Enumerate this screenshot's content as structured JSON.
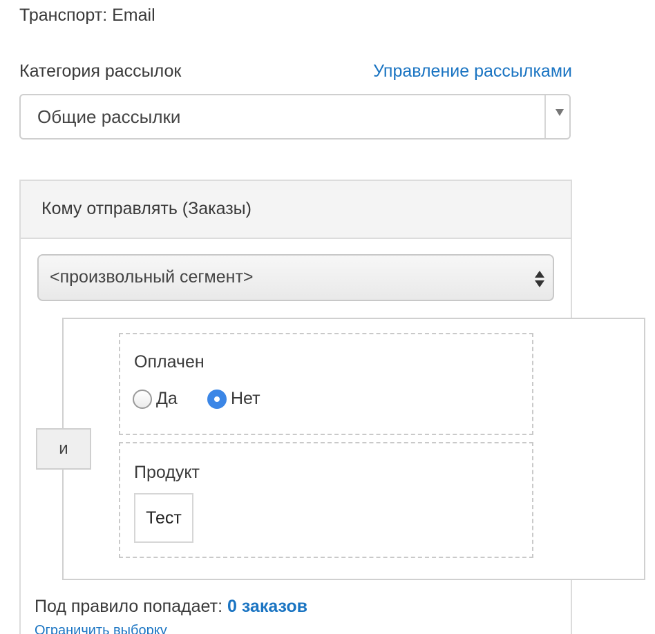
{
  "transport": {
    "label": "Транспорт: Email"
  },
  "category": {
    "label": "Категория рассылок",
    "manage_link": "Управление рассылками",
    "selected": "Общие рассылки"
  },
  "recipients": {
    "title": "Кому отправлять (Заказы)",
    "segment_selected": "<произвольный сегмент>",
    "combinator": "и",
    "conditions": {
      "paid": {
        "title": "Оплачен",
        "options": [
          {
            "label": "Да",
            "checked": false
          },
          {
            "label": "Нет",
            "checked": true
          }
        ]
      },
      "product": {
        "title": "Продукт",
        "value": "Тест"
      }
    }
  },
  "result": {
    "prefix": "Под правило попадает:",
    "count": "0 заказов",
    "limit_link": "Ограничить выборку"
  },
  "colors": {
    "link": "#1a74c2",
    "radio_active": "#3b86e6"
  }
}
